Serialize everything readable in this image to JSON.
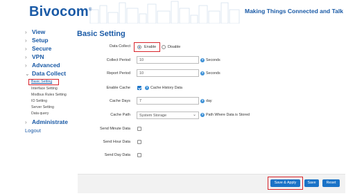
{
  "header": {
    "logo_text": "Bivocom",
    "logo_mark": "®",
    "tagline": "Making Things Connected and Talk",
    "brand_color": "#1a5aa6"
  },
  "sidebar": {
    "items": [
      {
        "label": "View",
        "icon": "chevron-right-icon"
      },
      {
        "label": "Setup",
        "icon": "chevron-right-icon"
      },
      {
        "label": "Secure",
        "icon": "chevron-right-icon"
      },
      {
        "label": "VPN",
        "icon": "chevron-right-icon"
      },
      {
        "label": "Advanced",
        "icon": "chevron-right-icon"
      },
      {
        "label": "Data Collect",
        "icon": "chevron-down-icon"
      }
    ],
    "sub_items": [
      {
        "label": "Basic Setting",
        "active": true
      },
      {
        "label": "Interface Setting"
      },
      {
        "label": "Modbus Rules Setting"
      },
      {
        "label": "IO Setting"
      },
      {
        "label": "Server Setting"
      },
      {
        "label": "Data query"
      }
    ],
    "administrate": {
      "label": "Administrate",
      "icon": "chevron-right-icon"
    },
    "logout": "Logout"
  },
  "main": {
    "title": "Basic Setting",
    "data_collect": {
      "label": "Data Collect",
      "options": [
        "Enable",
        "Disable"
      ],
      "selected": "Enable"
    },
    "collect_period": {
      "label": "Collect Period",
      "value": "10",
      "unit": "Seconds"
    },
    "report_period": {
      "label": "Report Period",
      "value": "10",
      "unit": "Seconds"
    },
    "enable_cache": {
      "label": "Enable Cache",
      "checked": true,
      "hint": "Cache History Data"
    },
    "cache_days": {
      "label": "Cache Days",
      "value": "7",
      "unit": "day"
    },
    "cache_path": {
      "label": "Cache Path",
      "value": "System Storage",
      "hint": "Path Where Data is Stored"
    },
    "send_minute": {
      "label": "Send Minute Data",
      "checked": false
    },
    "send_hour": {
      "label": "Send Hour Data",
      "checked": false
    },
    "send_day": {
      "label": "Send Day Data",
      "checked": false
    }
  },
  "footer": {
    "save_apply": "Save & Apply",
    "save": "Save",
    "reset": "Reset",
    "button_color": "#1a73c7",
    "highlight_color": "#d8232a"
  }
}
